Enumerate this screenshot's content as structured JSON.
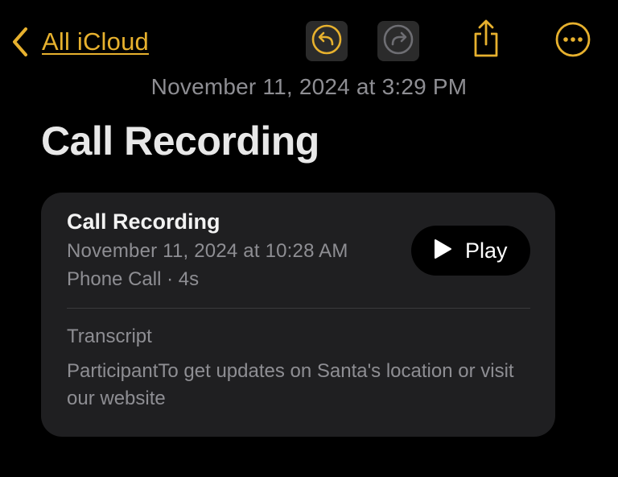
{
  "nav": {
    "back_label": "All iCloud",
    "accent_color": "#E7B12E",
    "icons": [
      "chevron-left-icon",
      "undo-icon",
      "redo-icon",
      "share-icon",
      "more-icon"
    ]
  },
  "note": {
    "date": "November 11, 2024 at 3:29 PM",
    "title": "Call Recording"
  },
  "recording": {
    "title": "Call Recording",
    "date": "November 11, 2024 at 10:28 AM",
    "meta": "Phone Call · 4s",
    "play_label": "Play",
    "transcript_heading": "Transcript",
    "transcript_text": "ParticipantTo get updates on Santa's location or visit our website"
  }
}
